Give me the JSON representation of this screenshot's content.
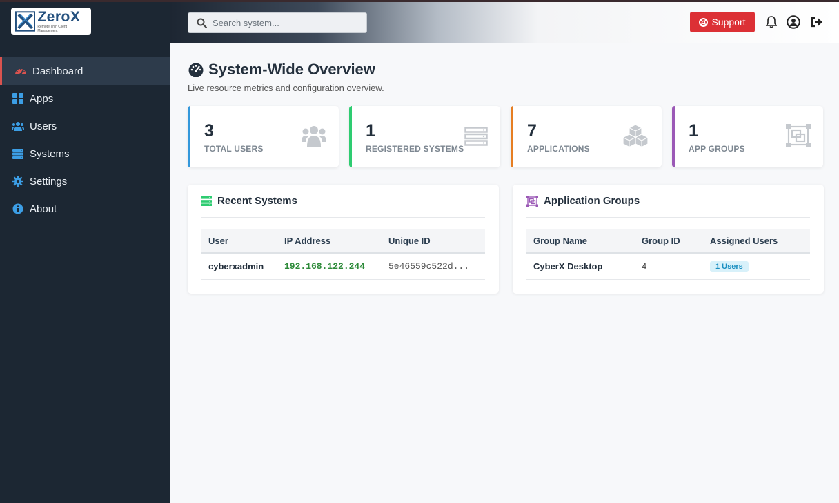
{
  "brand": {
    "name": "ZeroX",
    "tagline": "Remote Thin Client Management"
  },
  "sidebar": {
    "items": [
      {
        "label": "Dashboard",
        "icon": "tachometer-icon",
        "active": true
      },
      {
        "label": "Apps",
        "icon": "grid-icon"
      },
      {
        "label": "Users",
        "icon": "users-icon"
      },
      {
        "label": "Systems",
        "icon": "server-icon"
      },
      {
        "label": "Settings",
        "icon": "gear-icon"
      },
      {
        "label": "About",
        "icon": "info-icon"
      }
    ]
  },
  "header": {
    "search_placeholder": "Search system...",
    "support_label": "Support"
  },
  "page": {
    "title": "System-Wide Overview",
    "subtitle": "Live resource metrics and configuration overview."
  },
  "stats": [
    {
      "value": "3",
      "label": "TOTAL USERS",
      "color": "#3498db"
    },
    {
      "value": "1",
      "label": "REGISTERED SYSTEMS",
      "color": "#2ecc71"
    },
    {
      "value": "7",
      "label": "APPLICATIONS",
      "color": "#e67e22"
    },
    {
      "value": "1",
      "label": "APP GROUPS",
      "color": "#9b59b6"
    }
  ],
  "recent_systems": {
    "title": "Recent Systems",
    "columns": [
      "User",
      "IP Address",
      "Unique ID"
    ],
    "rows": [
      {
        "user": "cyberxadmin",
        "ip": "192.168.122.244",
        "uid": "5e46559c522d..."
      }
    ]
  },
  "app_groups": {
    "title": "Application Groups",
    "columns": [
      "Group Name",
      "Group ID",
      "Assigned Users"
    ],
    "rows": [
      {
        "name": "CyberX Desktop",
        "id": "4",
        "users": "1 Users"
      }
    ]
  }
}
